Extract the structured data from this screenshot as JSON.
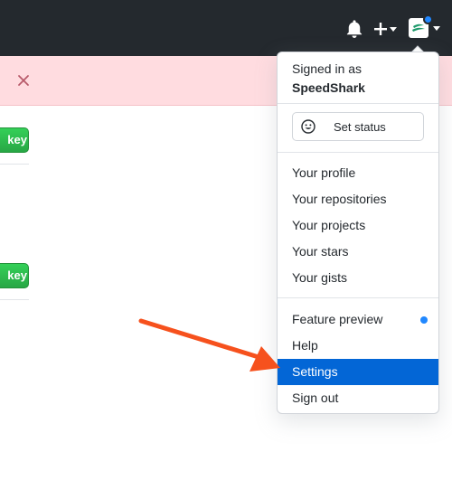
{
  "header": {
    "icons": [
      "bell-icon",
      "plus-icon",
      "avatar",
      "caret-down-icon"
    ],
    "notification_dot_color": "#2188ff"
  },
  "flash": {
    "icon": "close-icon",
    "background": "#ffdce0"
  },
  "page": {
    "buttons": [
      {
        "label": "key"
      },
      {
        "label": "key"
      }
    ],
    "button_color": "#2ea44f"
  },
  "dropdown": {
    "signed_in_label": "Signed in as",
    "username": "SpeedShark",
    "set_status_label": "Set status",
    "set_status_icon": "smiley-icon",
    "items_group1": [
      "Your profile",
      "Your repositories",
      "Your projects",
      "Your stars",
      "Your gists"
    ],
    "items_group2": [
      "Feature preview",
      "Help",
      "Settings",
      "Sign out"
    ],
    "highlighted_item": "Settings",
    "highlight_color": "#0366d6"
  },
  "annotation": {
    "icon": "arrow-icon",
    "color": "#f6511d"
  }
}
